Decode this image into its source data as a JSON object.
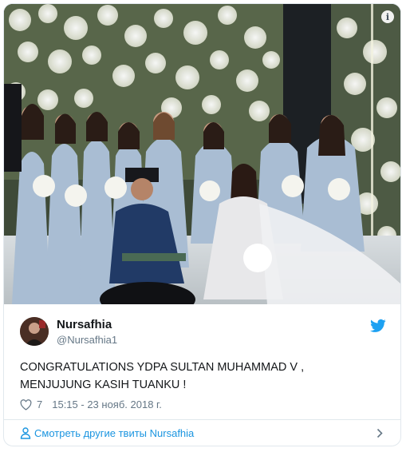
{
  "tweet": {
    "display_name": "Nursafhia",
    "handle": "@Nursafhia1",
    "text": "CONGRATULATIONS YDPA SULTAN MUHAMMAD V ,\nMENJUJUNG KASIH TUANKU !",
    "like_count": "7",
    "timestamp": "15:15 - 23 нояб. 2018 г.",
    "more_tweets_label": "Смотреть другие твиты Nursafhia"
  },
  "icons": {
    "info": "info-icon",
    "twitter": "twitter-bird-icon",
    "like": "heart-icon",
    "profile": "person-icon",
    "chevron": "chevron-right-icon"
  },
  "colors": {
    "twitter_blue": "#1da1f2",
    "link_blue": "#1b95e0",
    "muted": "#657786",
    "text": "#14171a",
    "border": "#e1e8ed"
  }
}
